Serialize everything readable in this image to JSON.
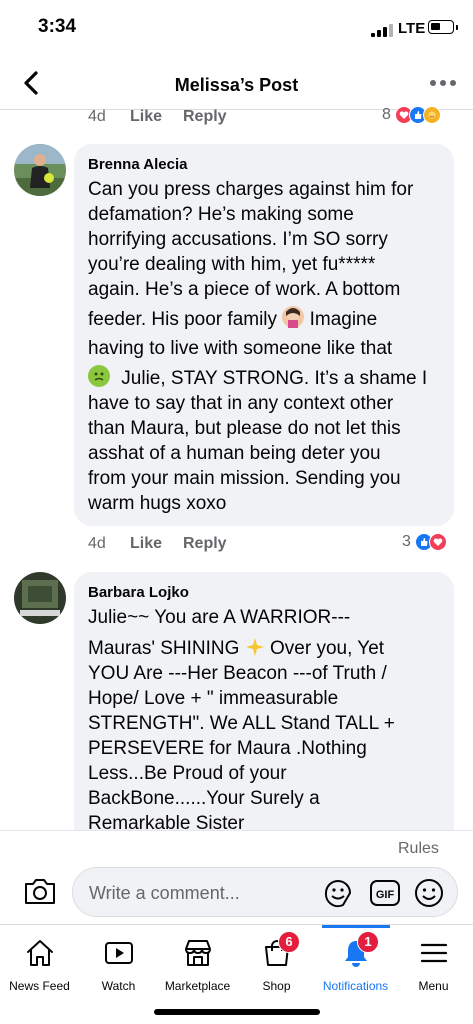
{
  "status_bar": {
    "time": "3:34",
    "network": "LTE"
  },
  "header": {
    "title": "Melissa’s Post"
  },
  "previous_comment": {
    "time": "4d",
    "like_label": "Like",
    "reply_label": "Reply",
    "reaction_count": "8"
  },
  "comments": [
    {
      "author": "Brenna Alecia",
      "lines": [
        "Can you press charges against him for",
        "defamation? He’s making some",
        "horrifying accusations. I’m SO sorry",
        "you’re dealing with him, yet fu*****",
        "again. He’s a piece of work. A bottom",
        "feeder. His poor family",
        "Imagine",
        "having to live with someone like that",
        "Julie, STAY STRONG. It’s a shame I",
        "have to say that in any context other",
        "than Maura, but please do not let this",
        "asshat of a human being deter you",
        "from your main mission. Sending you",
        "warm hugs xoxo"
      ],
      "time": "4d",
      "like_label": "Like",
      "reply_label": "Reply",
      "reaction_count": "3"
    },
    {
      "author": "Barbara Lojko",
      "lines": [
        "Julie~~ You are A WARRIOR---",
        "Mauras' SHINING",
        "Over you, Yet",
        "YOU Are ---Her Beacon ---of Truth /",
        "Hope/ Love +  \" immeasurable",
        "STRENGTH\". We ALL Stand TALL +",
        "PERSEVERE for  Maura .Nothing",
        "Less...Be Proud of your",
        "BackBone......Your  Surely a",
        "Remarkable Sister"
      ]
    }
  ],
  "composer": {
    "rules_label": "Rules",
    "placeholder": "Write a comment..."
  },
  "bottom_nav": [
    {
      "label": "News Feed",
      "icon": "home-icon"
    },
    {
      "label": "Watch",
      "icon": "watch-icon"
    },
    {
      "label": "Marketplace",
      "icon": "marketplace-icon"
    },
    {
      "label": "Shop",
      "icon": "shop-icon",
      "badge": "6"
    },
    {
      "label": "Notifications",
      "icon": "bell-icon",
      "badge": "1"
    },
    {
      "label": "Menu",
      "icon": "menu-icon"
    }
  ],
  "colors": {
    "accent": "#1877f2",
    "badge": "#e41e3f",
    "bubble": "#f0f2f5",
    "secondary_text": "#65676b"
  }
}
